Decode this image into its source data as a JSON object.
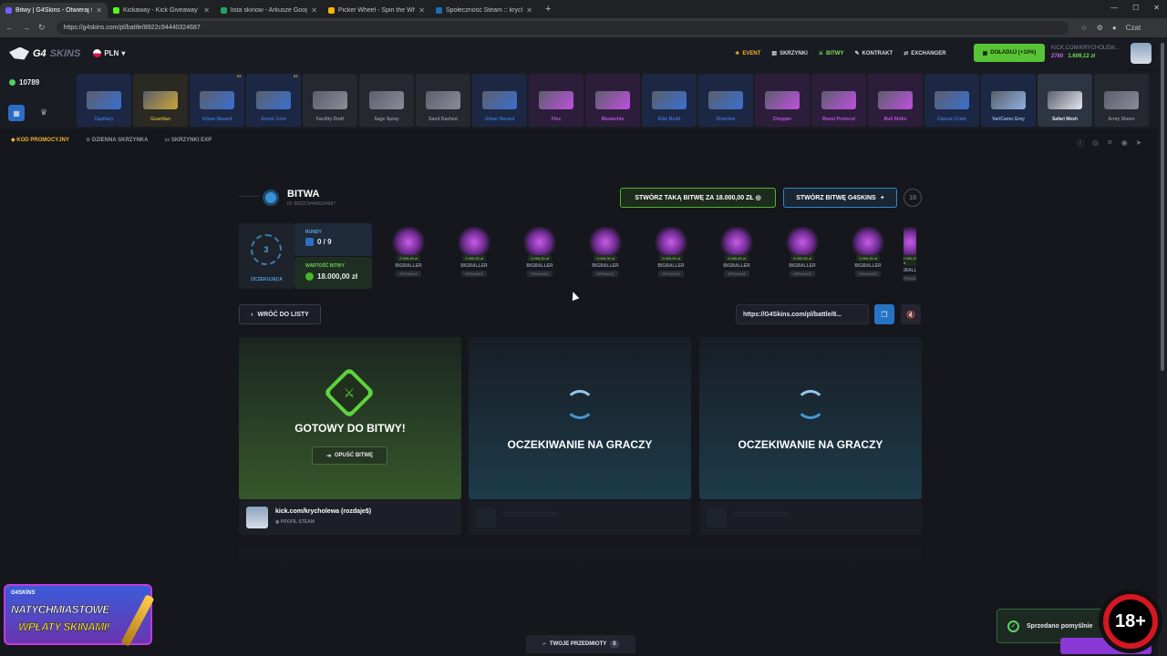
{
  "browser": {
    "tabs": [
      {
        "title": "Bitwy | G4Skins - Otwieraj skrzynki",
        "color": "#7a5cff",
        "active": true
      },
      {
        "title": "Kickaway - Kick Giveaway Tool",
        "color": "#53fc18",
        "active": false
      },
      {
        "title": "lista skinow - Arkusze Google",
        "color": "#1fa463",
        "active": false
      },
      {
        "title": "Picker Wheel - Spin the Wheel to",
        "color": "#f5b400",
        "active": false
      },
      {
        "title": "Społeczność Steam :: krycholewa",
        "color": "#1b6fb5",
        "active": false
      }
    ],
    "new_tab": "+",
    "url": "https://g4skins.com/pl/battle/8922c944403246​87",
    "profile_label": "Czat"
  },
  "site": {
    "logo_a": "G4",
    "logo_b": "SKINS",
    "currency": "PLN",
    "nav": [
      {
        "label": "EVENT",
        "icon": "star-icon"
      },
      {
        "label": "SKRZYNKI",
        "icon": "box-icon"
      },
      {
        "label": "BITWY",
        "icon": "battle-icon"
      },
      {
        "label": "KONTRAKT",
        "icon": "pen-icon"
      },
      {
        "label": "EXCHANGER",
        "icon": "exchange-icon"
      }
    ],
    "deposit": "DOŁADUJ (+10%)",
    "user_name": "KICK.COM/KRYCHOLEW...",
    "balance_points": "2760",
    "balance_money": "1.609,12 zł"
  },
  "drops": {
    "online": "10789",
    "items": [
      {
        "name": "Capillary",
        "color": "#3a6fd1",
        "bg": "#1c2843"
      },
      {
        "name": "Guardian",
        "color": "#c9a43a",
        "bg": "#2a2a22"
      },
      {
        "name": "Urban Hazard",
        "color": "#3a6fd1",
        "bg": "#1c2843",
        "badge": "ST"
      },
      {
        "name": "Armor Core",
        "color": "#3a6fd1",
        "bg": "#1c2843",
        "badge": "ST"
      },
      {
        "name": "Facility Draft",
        "color": "#8a8d98",
        "bg": "#26282f"
      },
      {
        "name": "Sage Spray",
        "color": "#8a8d98",
        "bg": "#26282f"
      },
      {
        "name": "Sand Dashed",
        "color": "#8a8d98",
        "bg": "#26282f"
      },
      {
        "name": "Urban Hazard",
        "color": "#3a6fd1",
        "bg": "#1c2843"
      },
      {
        "name": "Flex",
        "color": "#c04fe0",
        "bg": "#2c1e3a"
      },
      {
        "name": "Mustachio",
        "color": "#c04fe0",
        "bg": "#2c1e3a"
      },
      {
        "name": "Elite Build",
        "color": "#3a6fd1",
        "bg": "#1c2843"
      },
      {
        "name": "Directive",
        "color": "#3a6fd1",
        "bg": "#1c2843"
      },
      {
        "name": "Chopper",
        "color": "#c04fe0",
        "bg": "#2c1e3a"
      },
      {
        "name": "Boost Protocol",
        "color": "#c04fe0",
        "bg": "#2c1e3a"
      },
      {
        "name": "Bull Strike",
        "color": "#c04fe0",
        "bg": "#2c1e3a"
      },
      {
        "name": "Classic Crate",
        "color": "#3a6fd1",
        "bg": "#1c2843"
      },
      {
        "name": "VariCamo Grey",
        "color": "#8fb0e0",
        "bg": "#1c2843"
      },
      {
        "name": "Safari Mesh",
        "color": "#e6e8ee",
        "bg": "#2d3442"
      },
      {
        "name": "Army Sheen",
        "color": "#8a8d98",
        "bg": "#26282f"
      }
    ]
  },
  "subnav": {
    "promo": "KOD PROMOCYJNY",
    "daily": "DZIENNA SKRZYNKA",
    "exp": "SKRZYNKI EXP"
  },
  "battle": {
    "title": "BITWA",
    "id": "ID: 8922C944403246​87",
    "create_same": "STWÓRZ TAKĄ BITWĘ ZA 18.000,00 ZŁ",
    "create_g4": "STWÓRZ BITWĘ G4SKINS",
    "age": "18",
    "status_num": "3",
    "status": "OCZEKUJĄCA",
    "rounds_label": "RUNDY",
    "rounds": "0 / 9",
    "value_label": "WARTOŚĆ BITWY",
    "value": "18.000,00 zł",
    "case_price": "2.000,00 zł",
    "case_name": "BIGBALLER",
    "case_check": "SPRAWDŹ",
    "back": "WRÓĆ DO LISTY",
    "link": "https://G4Skins.com/pl/battle/8...",
    "ready": "GOTOWY DO BITWY!",
    "leave": "OPUŚĆ BITWĘ",
    "waiting": "OCZEKIWANIE NA GRACZY",
    "player_name": "kick.com/krycholewa (rozdaje$)",
    "player_sub": "PROFIL STEAM"
  },
  "promo": {
    "brand": "G4SKINS",
    "line1": "NATYCHMIASTOWE",
    "line2": "WPŁATY SKINAMI!"
  },
  "footer": {
    "items": "TWOJE PRZEDMIOTY",
    "items_count": "0",
    "toast": "Sprzedano pomyślnie",
    "age_badge": "18+"
  }
}
